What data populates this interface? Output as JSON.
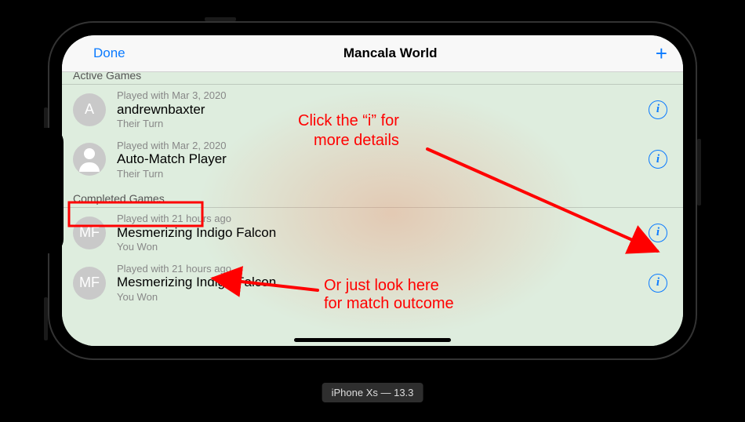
{
  "navbar": {
    "done_label": "Done",
    "title": "Mancala World",
    "add_glyph": "+"
  },
  "sections": {
    "active_header": "Active Games",
    "completed_header": "Completed Games"
  },
  "rows": [
    {
      "avatar_text": "A",
      "avatar_type": "letter",
      "meta": "Played with Mar 3, 2020",
      "name": "andrewnbaxter",
      "status": "Their Turn"
    },
    {
      "avatar_text": "",
      "avatar_type": "silhouette",
      "meta": "Played with Mar 2, 2020",
      "name": "Auto-Match Player",
      "status": "Their Turn"
    },
    {
      "avatar_text": "MF",
      "avatar_type": "letter",
      "meta": "Played with 21 hours ago",
      "name": "Mesmerizing Indigo Falcon",
      "status": "You Won"
    },
    {
      "avatar_text": "MF",
      "avatar_type": "letter",
      "meta": "Played with 21 hours ago",
      "name": "Mesmerizing Indigo Falcon",
      "status": "You Won"
    }
  ],
  "info_glyph": "i",
  "annotations": {
    "line1a": "Click the “i” for",
    "line1b": "more details",
    "line2a": "Or just look here",
    "line2b": "for match outcome"
  },
  "caption": "iPhone Xs — 13.3",
  "colors": {
    "accent_blue": "#0a7aff",
    "annotation_red": "#ff0000"
  }
}
